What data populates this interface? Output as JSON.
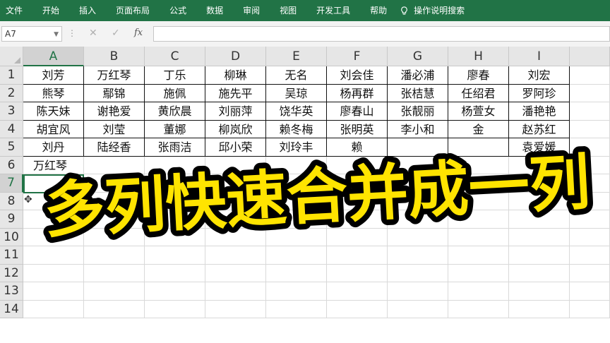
{
  "ribbon": {
    "tabs": [
      "文件",
      "开始",
      "插入",
      "页面布局",
      "公式",
      "数据",
      "审阅",
      "视图",
      "开发工具",
      "帮助"
    ],
    "tell_me": "操作说明搜索",
    "accent": "#217346"
  },
  "formula_bar": {
    "name_box": "A7",
    "fx_label": "fx",
    "value": ""
  },
  "sheet": {
    "columns": [
      "A",
      "B",
      "C",
      "D",
      "E",
      "F",
      "G",
      "H",
      "I"
    ],
    "rows": [
      "1",
      "2",
      "3",
      "4",
      "5",
      "6",
      "7",
      "8",
      "9",
      "10",
      "11",
      "12",
      "13",
      "14"
    ],
    "data": [
      [
        "刘芳",
        "万红琴",
        "丁乐",
        "柳琳",
        "无名",
        "刘会佳",
        "潘必浦",
        "廖春",
        "刘宏"
      ],
      [
        "熊琴",
        "鄢锦",
        "施佩",
        "施先平",
        "吴琼",
        "杨再群",
        "张桔慧",
        "任绍君",
        "罗阿珍"
      ],
      [
        "陈天妹",
        "谢艳爱",
        "黄欣晨",
        "刘丽萍",
        "饶华英",
        "廖春山",
        "张靓丽",
        "杨萱女",
        "潘艳艳"
      ],
      [
        "胡宜风",
        "刘莹",
        "董娜",
        "柳岚欣",
        "赖冬梅",
        "张明英",
        "李小和",
        "金",
        "赵苏红"
      ],
      [
        "刘丹",
        "陆经香",
        "张雨洁",
        "邱小荣",
        "刘玲丰",
        "赖",
        "",
        "",
        "袁爱媛"
      ]
    ],
    "a6_value": "万红琴",
    "active_cell": "A7"
  },
  "overlay": {
    "headline": "多列快速合并成一列",
    "fill_color": "#ffe400",
    "stroke_color": "#000000"
  },
  "icons": {
    "tell_me": "lightbulb-icon",
    "cancel": "close-icon",
    "enter": "check-icon",
    "cursor": "cell-cursor-icon"
  }
}
